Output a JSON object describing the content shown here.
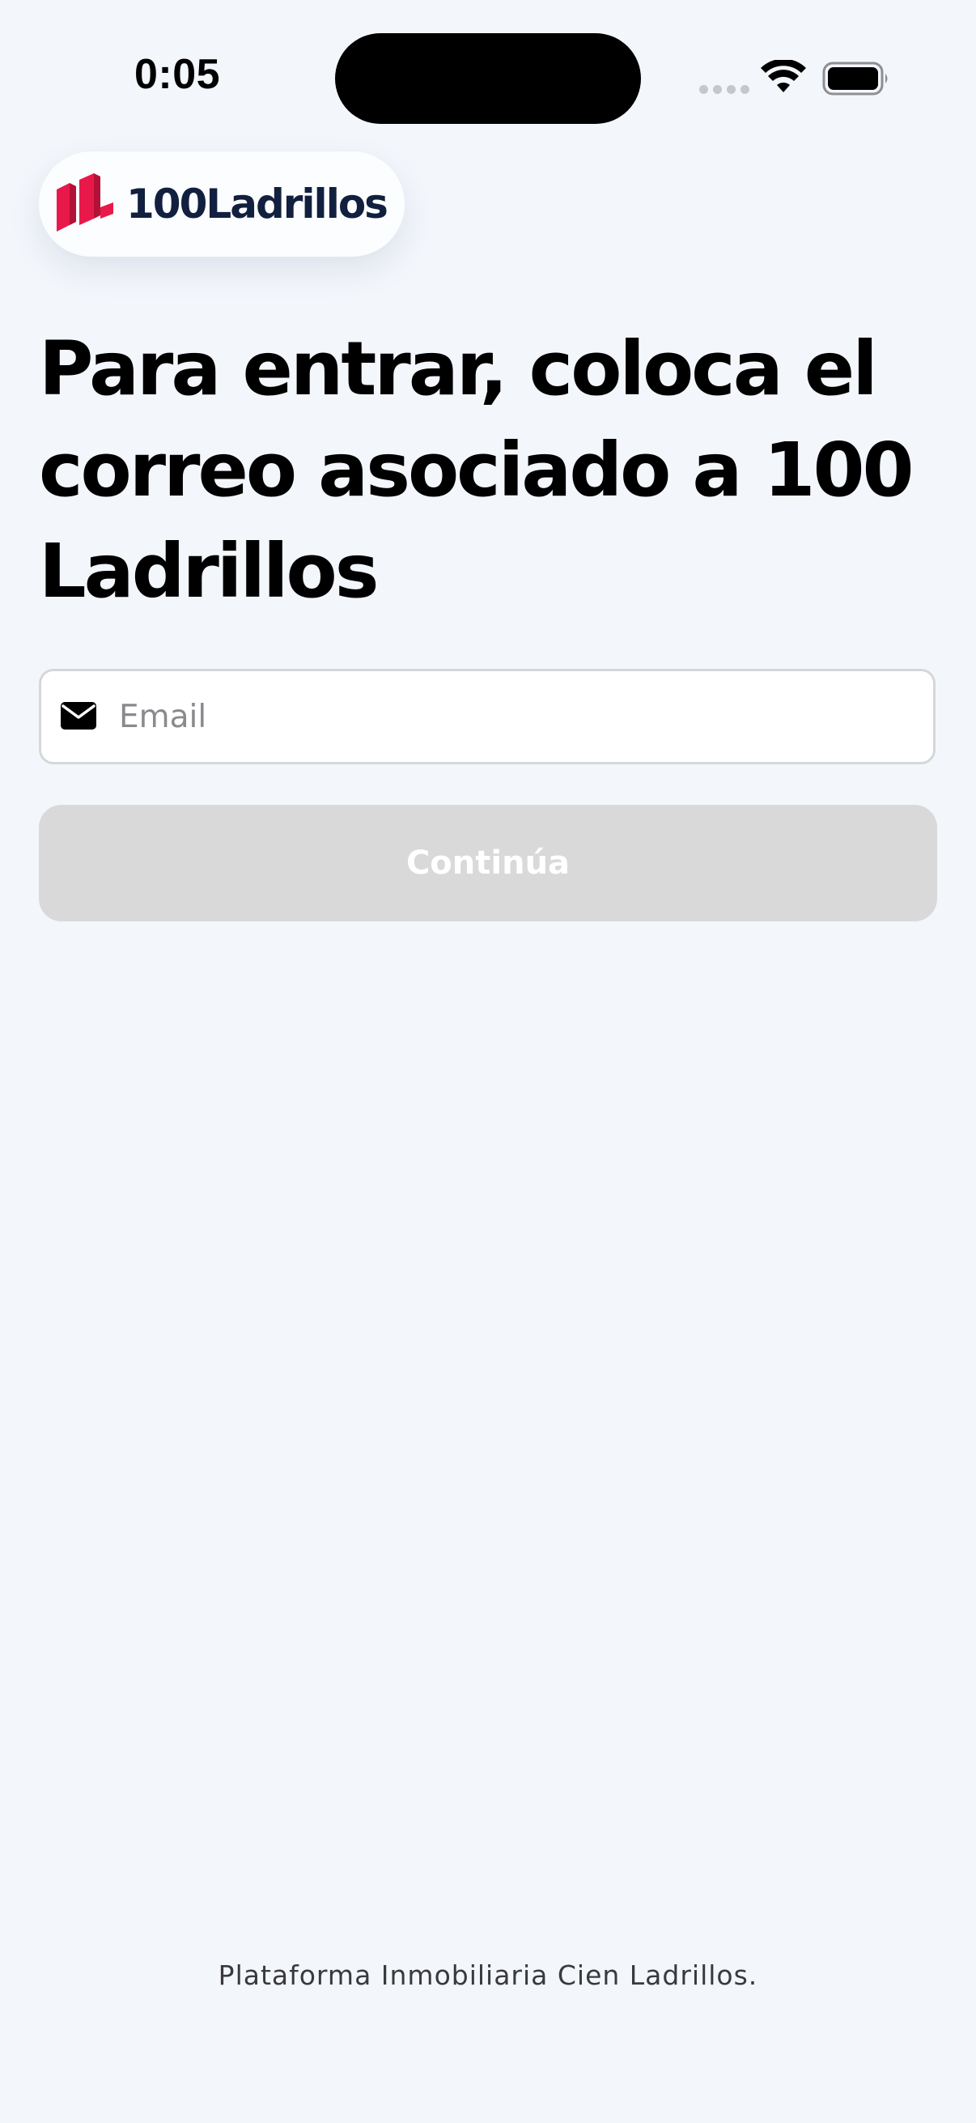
{
  "status_bar": {
    "time": "0:05",
    "icons": [
      "cellular-signal-icon",
      "wifi-icon",
      "battery-icon"
    ]
  },
  "logo": {
    "text": "100Ladrillos",
    "mark_color": "#e8194a",
    "text_color": "#12203f"
  },
  "login": {
    "heading": "Para entrar, coloca el correo asociado a 100 Ladrillos",
    "email_placeholder": "Email",
    "email_value": "",
    "continue_label": "Continúa",
    "continue_disabled": true
  },
  "footer": {
    "text": "Plataforma Inmobiliaria Cien Ladrillos."
  },
  "colors": {
    "background": "#f3f6fb",
    "button_disabled": "#d9d9d9",
    "brand_red": "#e8194a",
    "brand_navy": "#12203f"
  }
}
